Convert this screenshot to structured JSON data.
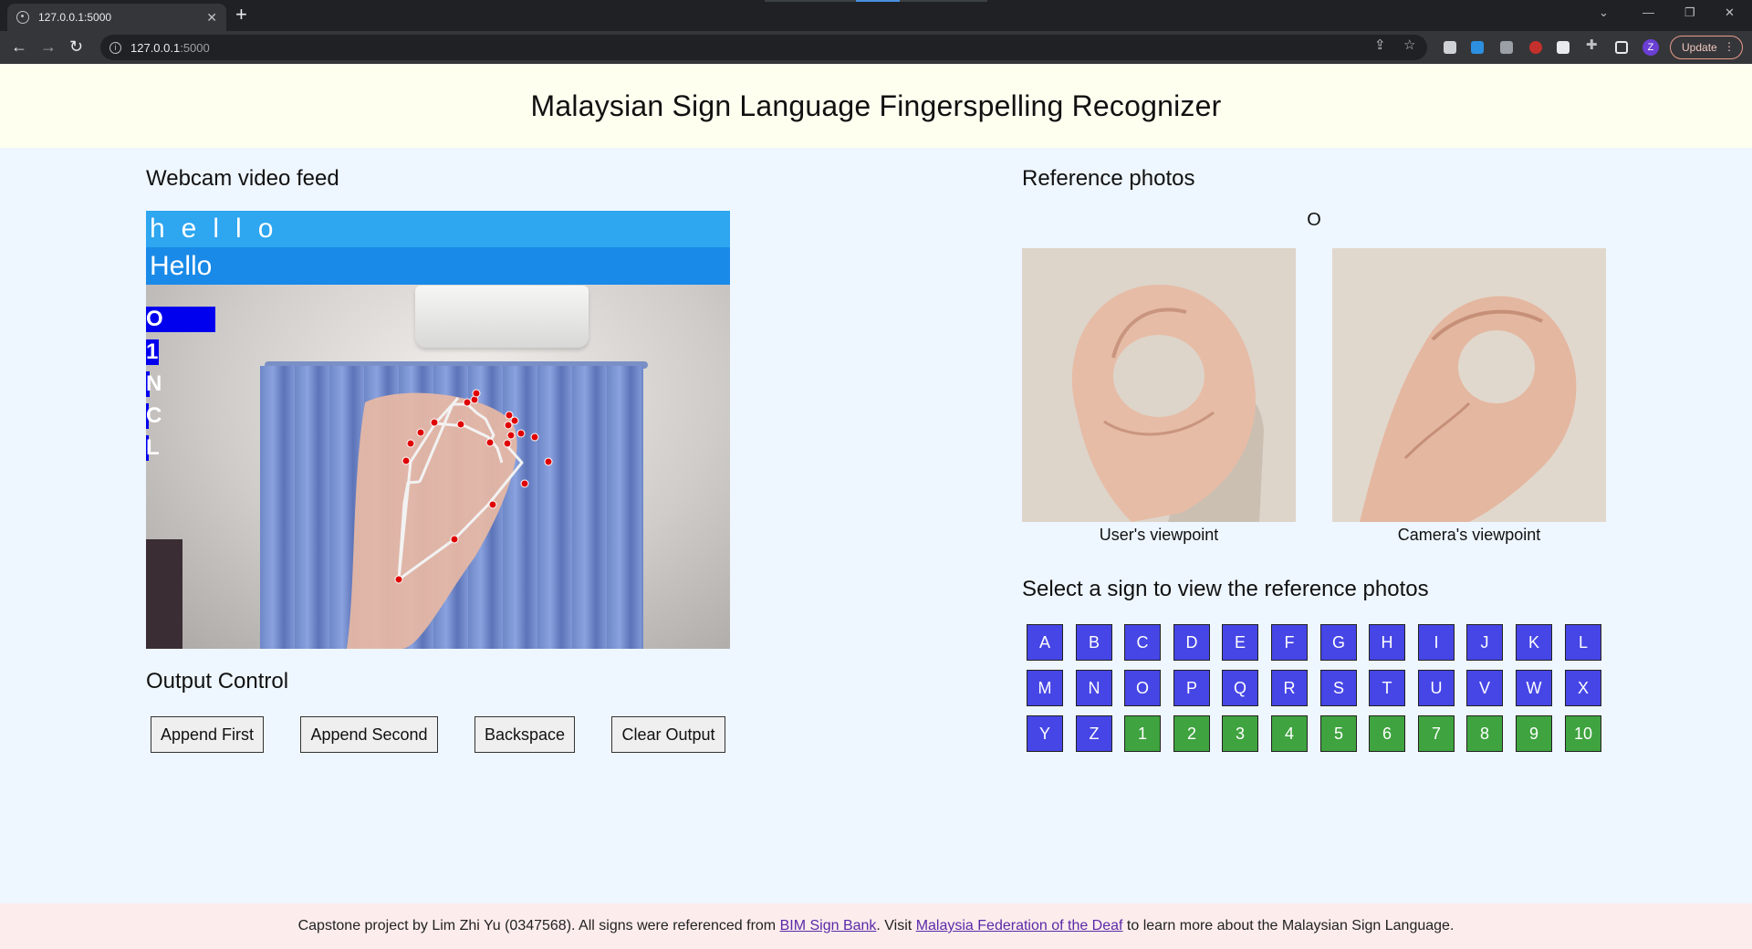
{
  "browser": {
    "tab_title": "127.0.0.1:5000",
    "url_host": "127.0.0.1",
    "url_port": ":5000",
    "profile_initial": "Z",
    "update_label": "Update"
  },
  "page": {
    "title": "Malaysian Sign Language Fingerspelling Recognizer"
  },
  "webcam": {
    "heading": "Webcam video feed",
    "raw_text": "hello",
    "formatted_text": "Hello",
    "predictions": [
      "O",
      "1",
      "N",
      "C",
      "L"
    ],
    "top_confidence": 0.12
  },
  "output_control": {
    "heading": "Output Control",
    "buttons": [
      "Append First",
      "Append Second",
      "Backspace",
      "Clear Output"
    ]
  },
  "reference": {
    "heading": "Reference photos",
    "current_sign": "O",
    "captions": [
      "User's viewpoint",
      "Camera's viewpoint"
    ]
  },
  "sign_selector": {
    "heading": "Select a sign to view the reference photos",
    "letters": [
      "A",
      "B",
      "C",
      "D",
      "E",
      "F",
      "G",
      "H",
      "I",
      "J",
      "K",
      "L",
      "M",
      "N",
      "O",
      "P",
      "Q",
      "R",
      "S",
      "T",
      "U",
      "V",
      "W",
      "X",
      "Y",
      "Z"
    ],
    "numbers": [
      "1",
      "2",
      "3",
      "4",
      "5",
      "6",
      "7",
      "8",
      "9",
      "10"
    ],
    "colors": {
      "letter": "#4646e6",
      "number": "#3fa33f"
    }
  },
  "footer": {
    "text_before": "Capstone project by Lim Zhi Yu (0347568). All signs were referenced from ",
    "link1": "BIM Sign Bank",
    "text_middle": ". Visit ",
    "link2": "Malaysia Federation of the Deaf",
    "text_after": " to learn more about the Malaysian Sign Language."
  }
}
